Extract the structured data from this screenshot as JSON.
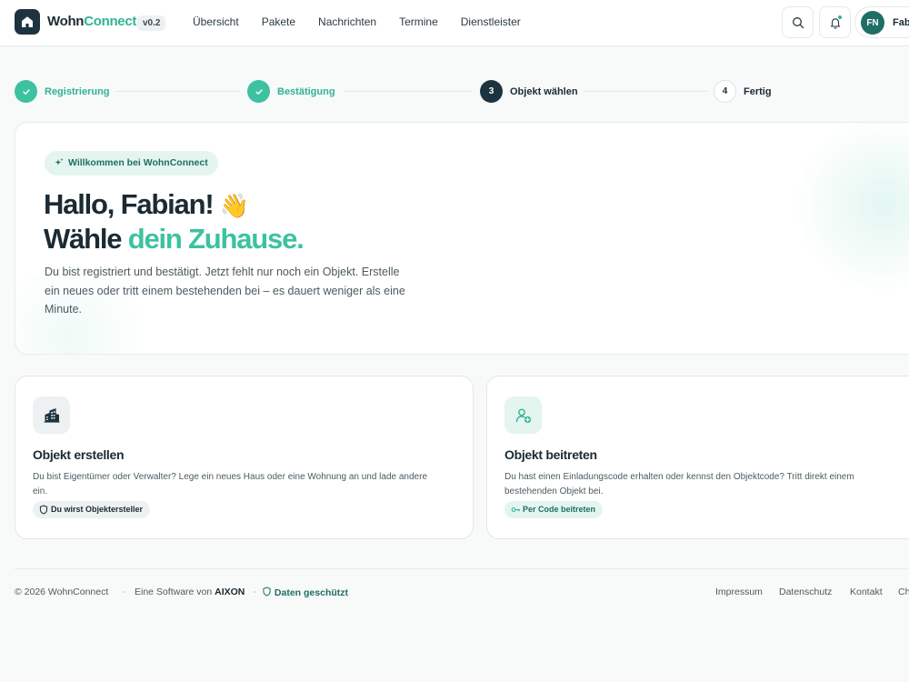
{
  "header": {
    "brand_dark": "Wohn",
    "brand_green": "Connect",
    "version": "v0.2",
    "nav": [
      "Übersicht",
      "Pakete",
      "Nachrichten",
      "Termine",
      "Dienstleister"
    ],
    "user_initials": "FN",
    "user_name": "Fab"
  },
  "stepper": {
    "steps": [
      {
        "label": "Registrierung",
        "state": "done",
        "number": ""
      },
      {
        "label": "Bestätigung",
        "state": "done",
        "number": ""
      },
      {
        "label": "Objekt wählen",
        "state": "active",
        "number": "3"
      },
      {
        "label": "Fertig",
        "state": "todo",
        "number": "4"
      }
    ]
  },
  "hero": {
    "welcome_pill": "Willkommen bei WohnConnect",
    "heading_line1": "Hallo, Fabian!",
    "wave_emoji": "👋",
    "heading_line2_plain": "Wähle ",
    "heading_line2_accent": "dein Zuhause.",
    "description": "Du bist registriert und bestätigt. Jetzt fehlt nur noch ein Objekt. Erstelle ein neues oder tritt einem bestehenden bei – es dauert weniger als eine Minute."
  },
  "cards": {
    "create": {
      "title": "Objekt erstellen",
      "text": "Du bist Eigentümer oder Verwalter? Lege ein neues Haus oder eine Wohnung an und lade andere ein.",
      "badge": "Du wirst Objektersteller",
      "icon": "building-icon"
    },
    "join": {
      "title": "Objekt beitreten",
      "text": "Du hast einen Einladungscode erhalten oder kennst den Objektcode? Tritt direkt einem bestehenden Objekt bei.",
      "badge": "Per Code beitreten",
      "icon": "user-plus-icon"
    }
  },
  "footer": {
    "copyright": "© 2026 WohnConnect",
    "software_prefix": "Eine Software von ",
    "software_company": "AIXON",
    "privacy_badge": "Daten geschützt",
    "links": [
      "Impressum",
      "Datenschutz",
      "Kontakt",
      "Ch"
    ]
  },
  "colors": {
    "accent": "#3cc2a0",
    "accent_dark": "#1f6e63",
    "navy": "#1d3440"
  }
}
